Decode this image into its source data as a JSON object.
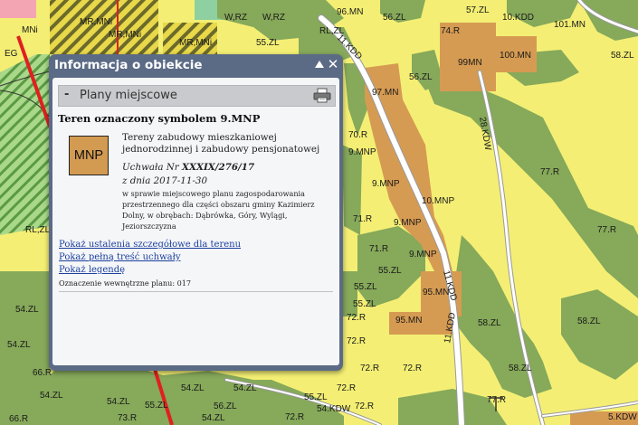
{
  "map": {
    "labels": [
      {
        "text": "96.MN"
      },
      {
        "text": "56.ZL"
      },
      {
        "text": "57.ZL"
      },
      {
        "text": "10.KDD"
      },
      {
        "text": "101.MN"
      },
      {
        "text": "MR,MNi"
      },
      {
        "text": "MR,MNi"
      },
      {
        "text": "MNi"
      },
      {
        "text": "EG"
      },
      {
        "text": "W,RZ"
      },
      {
        "text": "W,RZ"
      },
      {
        "text": "MR,MNi"
      },
      {
        "text": "55.ZL"
      },
      {
        "text": "11.KDD"
      },
      {
        "text": "RL,ZL"
      },
      {
        "text": "74.R"
      },
      {
        "text": "99MN"
      },
      {
        "text": "100.MN"
      },
      {
        "text": "58.ZL"
      },
      {
        "text": "56.ZL"
      },
      {
        "text": "97.MN"
      },
      {
        "text": "70.R"
      },
      {
        "text": "9.MNP"
      },
      {
        "text": "9.MNP"
      },
      {
        "text": "10.MNP"
      },
      {
        "text": "9.MNP"
      },
      {
        "text": "9.MNP"
      },
      {
        "text": "28.KDW"
      },
      {
        "text": "77.R"
      },
      {
        "text": "77.R"
      },
      {
        "text": "71.R"
      },
      {
        "text": "71.R"
      },
      {
        "text": "55.ZL"
      },
      {
        "text": "55.ZL"
      },
      {
        "text": "95.MN"
      },
      {
        "text": "95.MN"
      },
      {
        "text": "11.KDD"
      },
      {
        "text": "11.KDD"
      },
      {
        "text": "58.ZL"
      },
      {
        "text": "58.ZL"
      },
      {
        "text": "58.ZL"
      },
      {
        "text": "RL,ZL"
      },
      {
        "text": "54.ZL"
      },
      {
        "text": "55.ZL"
      },
      {
        "text": "72.R"
      },
      {
        "text": "72.R"
      },
      {
        "text": "54.ZL"
      },
      {
        "text": "66.R"
      },
      {
        "text": "54.ZL"
      },
      {
        "text": "54.ZL"
      },
      {
        "text": "72.R"
      },
      {
        "text": "72.R"
      },
      {
        "text": "55.ZL"
      },
      {
        "text": "72.R"
      },
      {
        "text": "72.R"
      },
      {
        "text": "77.R"
      },
      {
        "text": "54.ZL"
      },
      {
        "text": "54.ZL"
      },
      {
        "text": "55.ZL"
      },
      {
        "text": "54.KDW"
      },
      {
        "text": "54.ZL"
      },
      {
        "text": "72.R"
      },
      {
        "text": "73.R"
      },
      {
        "text": "66.R"
      },
      {
        "text": "5.KDW"
      },
      {
        "text": "56.ZL"
      }
    ]
  },
  "popup": {
    "title": "Informacja o obiekcie",
    "close_glyph": "✕",
    "section": {
      "toggle": "-",
      "title": "Plany miejscowe"
    },
    "area_title": "Teren oznaczony symbolem 9.MNP",
    "symbol": "MNP",
    "symbol_color": "#d39a52",
    "description": "Tereny zabudowy mieszkaniowej jednorodzinnej i zabudowy pensjonatowej",
    "resolution_prefix": "Uchwała Nr ",
    "resolution_number": "XXXIX/276/17",
    "resolution_date": "z dnia 2017-11-30",
    "subject": "w sprawie miejscowego planu zagospodarowania przestrzennego dla części obszaru gminy Kazimierz Dolny, w obrębach: Dąbrówka, Góry, Wylągi, Jeziorszczyzna",
    "links": [
      "Pokaż ustalenia szczegółowe dla terenu",
      "Pokaż pełną treść uchwały",
      "Pokaż legendę"
    ],
    "internal_label": "Oznaczenie wewnętrzne planu: 017"
  }
}
